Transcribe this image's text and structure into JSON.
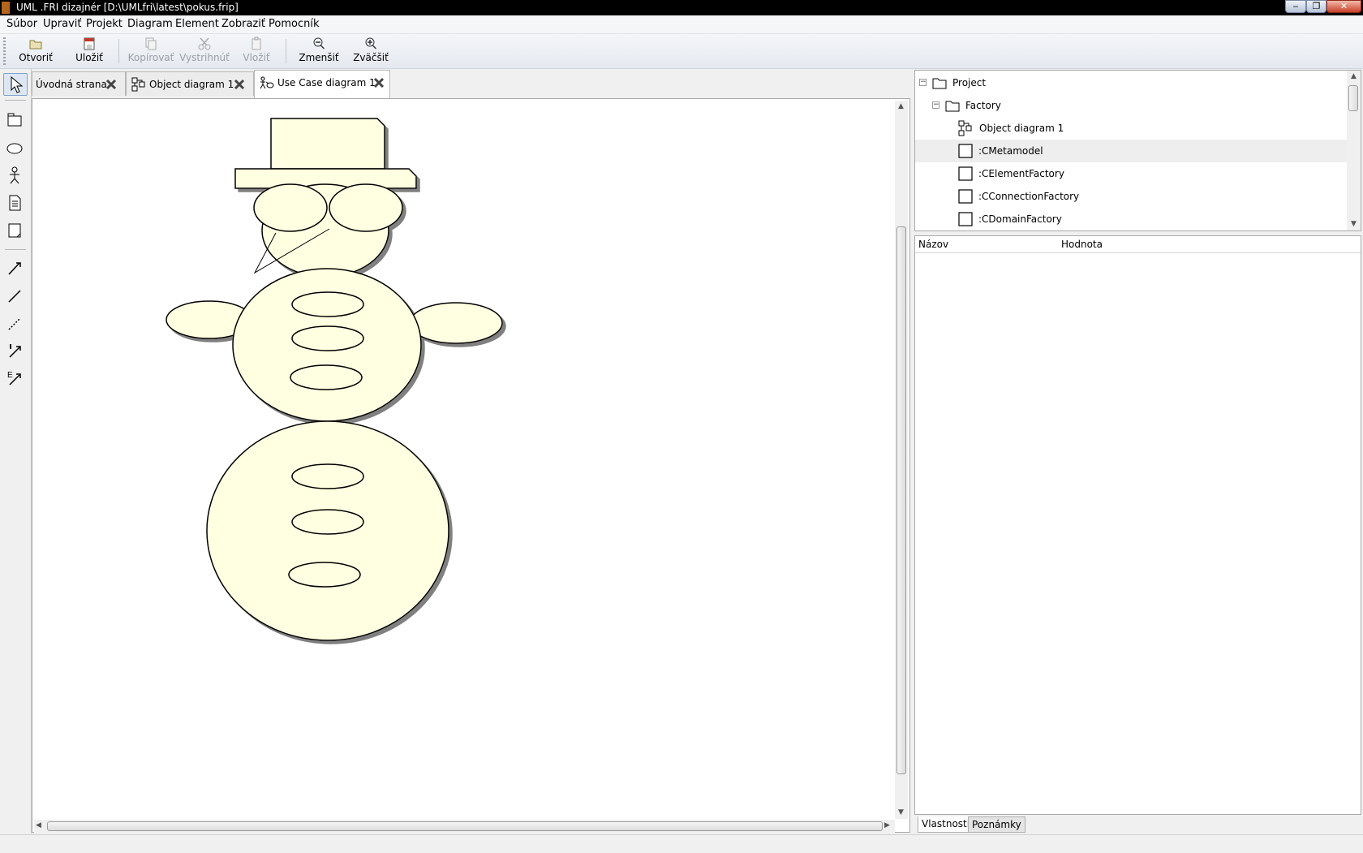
{
  "window": {
    "title": "UML .FRI dizajnér [D:\\UMLfri\\latest\\pokus.frip]"
  },
  "menu": [
    "Súbor",
    "Upraviť",
    "Projekt",
    "Diagram",
    "Element",
    "Zobraziť",
    "Pomocník"
  ],
  "toolbar": {
    "open": "Otvoriť",
    "save": "Uložiť",
    "copy": "Kopírovať",
    "cut": "Vystrihnúť",
    "paste": "Vložiť",
    "zoom_out": "Zmenšiť",
    "zoom_in": "Zväčšiť"
  },
  "tabs": [
    {
      "label": "Úvodná strana",
      "active": false
    },
    {
      "label": "Object diagram 1",
      "active": false
    },
    {
      "label": "Use Case diagram 1",
      "active": true
    }
  ],
  "tree": {
    "items": [
      {
        "label": "Project",
        "icon": "folder-icon",
        "expanded": true
      },
      {
        "label": "Factory",
        "icon": "folder-icon",
        "expanded": true
      },
      {
        "label": "Object diagram 1",
        "icon": "object-diagram-icon"
      },
      {
        "label": ":CMetamodel",
        "icon": "object-icon",
        "selected": true
      },
      {
        "label": ":CElementFactory",
        "icon": "object-icon"
      },
      {
        "label": ":CConnectionFactory",
        "icon": "object-icon"
      },
      {
        "label": ":CDomainFactory",
        "icon": "object-icon"
      }
    ]
  },
  "properties": {
    "col_name": "Názov",
    "col_value": "Hodnota"
  },
  "bottom_tabs": {
    "properties": "Vlastnosti",
    "notes": "Poznámky"
  },
  "colors": {
    "element_fill": "#ffffe1",
    "element_stroke": "#000000",
    "shadow": "#808080"
  }
}
